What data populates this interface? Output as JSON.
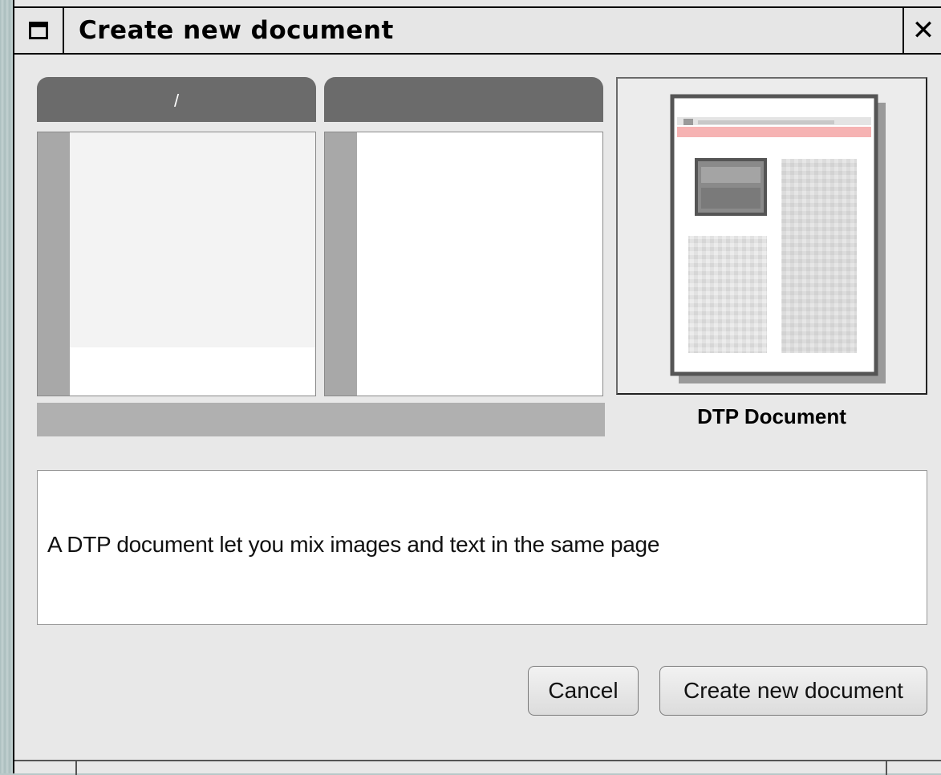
{
  "window": {
    "title": "Create new document",
    "close_glyph": "✕"
  },
  "browser": {
    "columns": [
      {
        "header": "/"
      },
      {
        "header": ""
      }
    ]
  },
  "preview": {
    "label": "DTP Document",
    "thumbnail_icon": "dtp-page-thumbnail-icon",
    "accent_color": "#f4a6a6"
  },
  "description": {
    "text": "A DTP document let you mix images and text in the same page"
  },
  "buttons": {
    "cancel": "Cancel",
    "create": "Create new document"
  }
}
